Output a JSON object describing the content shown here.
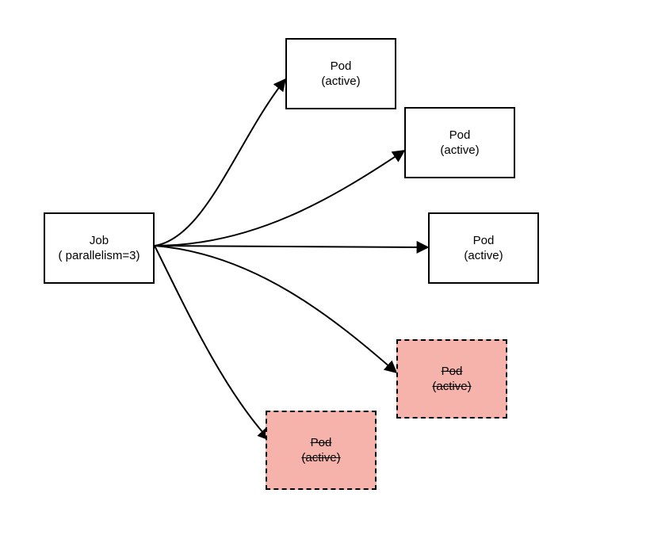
{
  "diagram": {
    "type": "architecture",
    "description": "Kubernetes Job with parallelism=3 spawning Pods; three active pods and two terminated pods",
    "source": {
      "title": "Job",
      "subtitle": "( parallelism=3)"
    },
    "pods": [
      {
        "id": "pod1",
        "title": "Pod",
        "subtitle": "(active)",
        "state": "active"
      },
      {
        "id": "pod2",
        "title": "Pod",
        "subtitle": "(active)",
        "state": "active"
      },
      {
        "id": "pod3",
        "title": "Pod",
        "subtitle": "(active)",
        "state": "active"
      },
      {
        "id": "pod4",
        "title": "Pod",
        "subtitle": "(active)",
        "state": "terminated"
      },
      {
        "id": "pod5",
        "title": "Pod",
        "subtitle": "(active)",
        "state": "terminated"
      }
    ]
  }
}
